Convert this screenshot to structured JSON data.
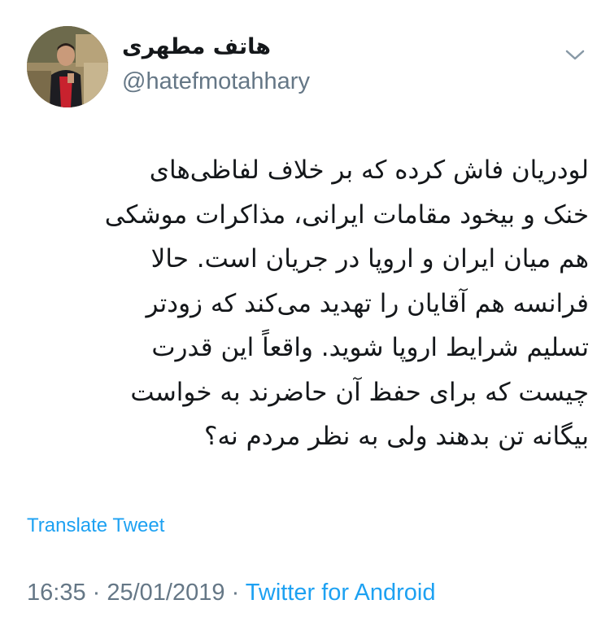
{
  "author": {
    "name": "هاتف مطهری",
    "handle": "@hatefmotahhary",
    "avatar": "profile-photo"
  },
  "tweet": {
    "lines": [
      "لودریان فاش کرده که بر خلاف لفاظی‌های",
      "خنک و بیخود مقامات ایرانی، مذاکرات موشکی",
      "هم میان ایران و اروپا در جریان است. حالا",
      "فرانسه هم آقایان را تهدید می‌کند که زودتر",
      "تسلیم شرایط اروپا شوید. واقعاً این قدرت",
      "چیست که برای حفظ آن حاضرند به خواست",
      "بیگانه تن بدهند ولی به نظر مردم نه؟"
    ],
    "translate_label": "Translate Tweet"
  },
  "meta": {
    "time": "16:35",
    "separator1": " · ",
    "date": "25/01/2019",
    "separator2": " · ",
    "source": "Twitter for Android"
  },
  "icons": {
    "menu": "chevron-down-icon"
  },
  "colors": {
    "link": "#1da1f2",
    "secondary_text": "#657786",
    "primary_text": "#14171a"
  }
}
